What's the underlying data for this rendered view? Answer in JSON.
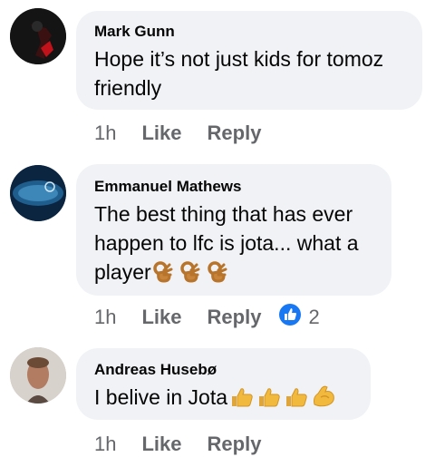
{
  "comments": [
    {
      "author": "Mark Gunn",
      "text_line1": "Hope it’s not just kids for tomoz",
      "text_line2": "friendly",
      "time": "1h",
      "like_label": "Like",
      "reply_label": "Reply"
    },
    {
      "author": "Emmanuel Mathews",
      "text_line1": "The best thing that has ever",
      "text_line2": "happen to lfc is jota... what a",
      "text_line3": "player",
      "time": "1h",
      "like_label": "Like",
      "reply_label": "Reply",
      "reaction_count": "2",
      "emojis": [
        "ok-hand-icon",
        "ok-hand-icon",
        "ok-hand-icon"
      ]
    },
    {
      "author": "Andreas Husebø",
      "text_line1": "I belive in Jota",
      "time": "1h",
      "like_label": "Like",
      "reply_label": "Reply",
      "emojis": [
        "thumbs-up-icon",
        "thumbs-up-icon",
        "thumbs-up-icon",
        "flexed-biceps-icon"
      ]
    }
  ],
  "colors": {
    "bubble": "#f0f2f5",
    "meta_text": "#65676b",
    "like_reaction": "#1877f2",
    "emoji_skin": "#e0a53a"
  }
}
